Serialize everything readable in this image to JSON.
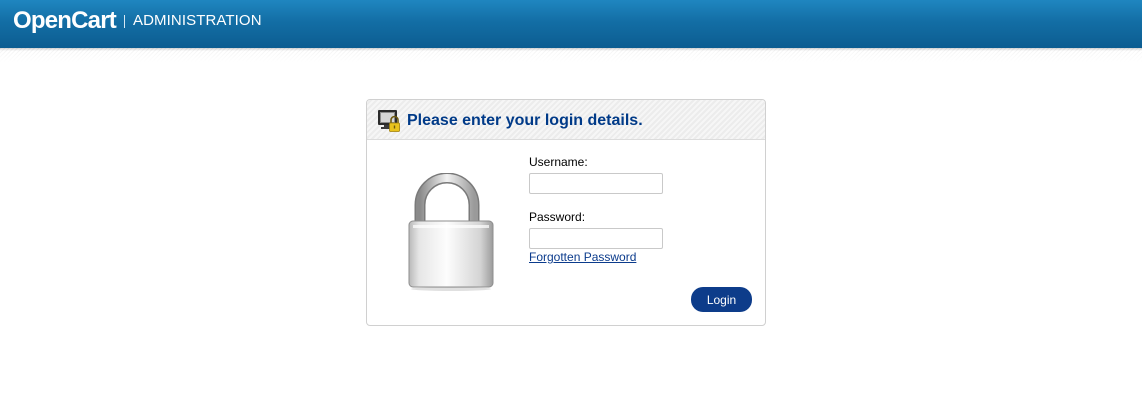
{
  "header": {
    "logo": "OpenCart",
    "subtitle": "ADMINISTRATION"
  },
  "login": {
    "heading": "Please enter your login details.",
    "username_label": "Username:",
    "username_value": "",
    "password_label": "Password:",
    "password_value": "",
    "forgot_link": "Forgotten Password",
    "login_button": "Login"
  },
  "colors": {
    "header_blue": "#136ea5",
    "heading_text": "#003a88",
    "button_bg": "#0d3c8a",
    "link": "#0b3b8c"
  },
  "icons": {
    "heading": "monitor-lock-icon",
    "illustration": "padlock-icon"
  }
}
